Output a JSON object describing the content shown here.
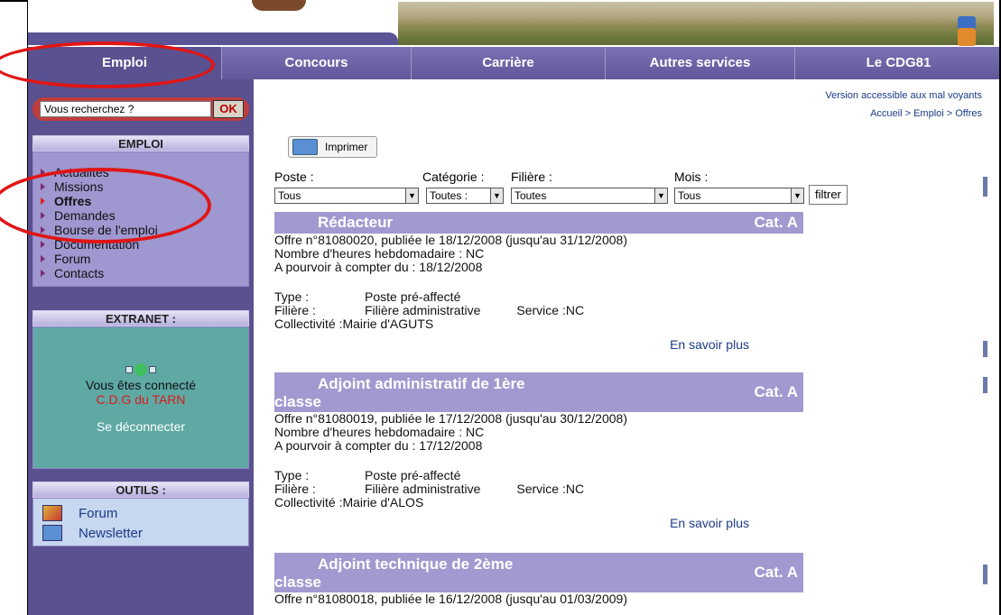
{
  "nav": {
    "items": [
      "Emploi",
      "Concours",
      "Carrière",
      "Autres services",
      "Le CDG81"
    ],
    "active_index": 0
  },
  "search": {
    "placeholder": "Vous recherchez ?",
    "button_label": "OK"
  },
  "sidebar": {
    "emploi": {
      "heading": "EMPLOI",
      "items": [
        "Actualités",
        "Missions",
        "Offres",
        "Demandes",
        "Bourse de l'emploi",
        "Documentation",
        "Forum",
        "Contacts"
      ],
      "active": "Offres"
    },
    "extranet": {
      "heading": "EXTRANET :",
      "connected_text": "Vous êtes connecté",
      "user": "C.D.G du TARN",
      "logout": "Se déconnecter"
    },
    "outils": {
      "heading": "OUTILS :",
      "items": [
        "Forum",
        "Newsletter"
      ]
    }
  },
  "content": {
    "access_link": "Version accessible aux mal voyants",
    "breadcrumb": "Accueil > Emploi > Offres",
    "print_label": "Imprimer",
    "filters": {
      "poste_label": "Poste :",
      "categorie_label": "Catégorie :",
      "filiere_label": "Filière :",
      "mois_label": "Mois :",
      "poste_value": "Tous",
      "categorie_value": "Toutes :",
      "filiere_value": "Toutes",
      "mois_value": "Tous",
      "button": "filtrer"
    },
    "offers": [
      {
        "title": "Rédacteur",
        "cat": "Cat. A",
        "line1": "Offre n°81080020, publiée le 18/12/2008 (jusqu'au 31/12/2008)",
        "line2": "Nombre d'heures hebdomadaire : NC",
        "line3": "A pourvoir à compter du : 18/12/2008",
        "type_label": "Type :",
        "type_value": "Poste pré-affecté",
        "filiere_label": "Filière :",
        "filiere_value": "Filière administrative",
        "service": "Service :NC",
        "collectivite": "Collectivité :Mairie d'AGUTS",
        "more": "En savoir plus"
      },
      {
        "title_l1": "Adjoint administratif de 1ère",
        "title_l2": "classe",
        "cat": "Cat. A",
        "line1": "Offre n°81080019, publiée le 17/12/2008 (jusqu'au 30/12/2008)",
        "line2": "Nombre d'heures hebdomadaire : NC",
        "line3": "A pourvoir à compter du : 17/12/2008",
        "type_label": "Type :",
        "type_value": "Poste pré-affecté",
        "filiere_label": "Filière :",
        "filiere_value": "Filière administrative",
        "service": "Service :NC",
        "collectivite": "Collectivité :Mairie d'ALOS",
        "more": "En savoir plus"
      },
      {
        "title_l1": "Adjoint technique de 2ème",
        "title_l2": "classe",
        "cat": "Cat. A",
        "line1": "Offre n°81080018, publiée le 16/12/2008 (jusqu'au 01/03/2009)"
      }
    ]
  }
}
